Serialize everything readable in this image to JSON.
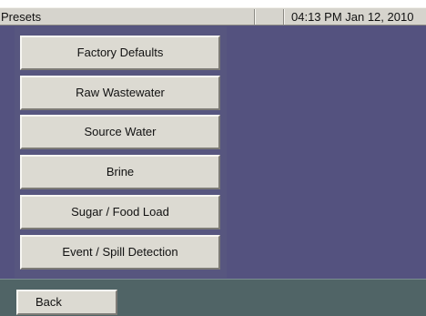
{
  "header": {
    "title": "Presets",
    "clock": "04:13 PM Jan 12, 2010"
  },
  "presets": {
    "items": [
      {
        "label": "Factory Defaults"
      },
      {
        "label": "Raw Wastewater"
      },
      {
        "label": "Source Water"
      },
      {
        "label": "Brine"
      },
      {
        "label": "Sugar / Food Load"
      },
      {
        "label": "Event / Spill Detection"
      }
    ]
  },
  "footer": {
    "back_label": "Back"
  },
  "colors": {
    "background": "#54527f",
    "button_face": "#dcdad2",
    "footer_bar": "#506466",
    "title_bar": "#d6d4cd"
  }
}
